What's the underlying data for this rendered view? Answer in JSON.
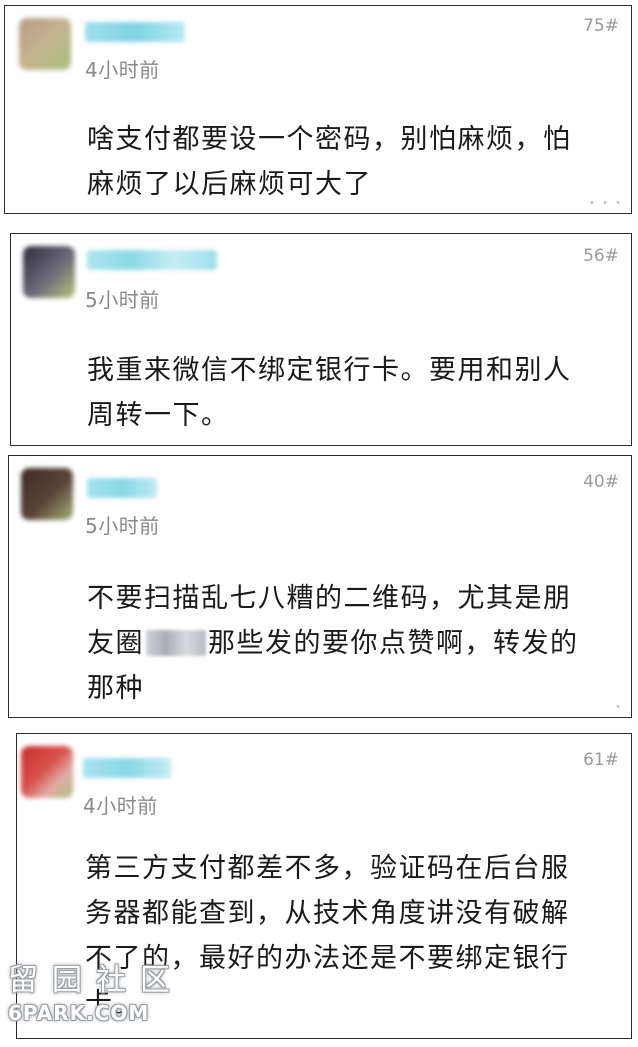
{
  "comments": [
    {
      "floor": "75#",
      "time": "4小时前",
      "lines": [
        "啥支付都要设一个密码，别怕麻烦，怕",
        "麻烦了以后麻烦可大了"
      ],
      "avatar_colors": [
        "#b89a8a",
        "#c4b48f",
        "#a8c07a"
      ]
    },
    {
      "floor": "56#",
      "time": "5小时前",
      "lines": [
        "我重来微信不绑定银行卡。要用和别人",
        "周转一下。"
      ],
      "avatar_colors": [
        "#2f2d3a",
        "#6d6a7a",
        "#b5c47a"
      ]
    },
    {
      "floor": "40#",
      "time": "5小时前",
      "lines_pre": "不要扫描乱七八糟的二维码，尤其是朋",
      "line2_pre": "友圈",
      "line2_post": "那些发的要你点赞啊，转发的",
      "line3": "那种",
      "avatar_colors": [
        "#3a2a24",
        "#5c4438",
        "#a3b27b"
      ]
    },
    {
      "floor": "61#",
      "time": "4小时前",
      "lines": [
        "第三方支付都差不多，验证码在后台服",
        "务器都能查到，从技术角度讲没有破解",
        "不了的，最好的办法还是不要绑定银行",
        "卡。"
      ],
      "avatar_colors": [
        "#c9302c",
        "#e2aaa6",
        "#a9c27d"
      ]
    }
  ],
  "watermark": {
    "cn": "留园社区",
    "en": "6PARK.COM"
  }
}
